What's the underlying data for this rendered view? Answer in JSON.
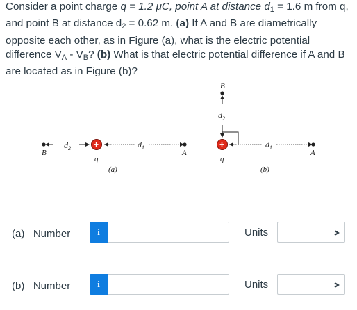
{
  "question": {
    "p1": "Consider a point charge ",
    "q_eq": "q = 1.2 μC, point A at distance d",
    "sub1": "1",
    "p2": " = 1.6 m from q, and point B at distance d",
    "sub2": "2",
    "p3": " = 0.62 m. ",
    "part_a_tag": "(a)",
    "p4": " If A and B are diametrically opposite each other, as in Figure (a), what is the electric potential difference V",
    "subA": "A",
    "p5": " - V",
    "subB": "B",
    "p6": "? ",
    "part_b_tag": "(b)",
    "p7": " What is that electric potential difference if A and B are located as in Figure (b)?"
  },
  "figure_a": {
    "label_B": "B",
    "label_d2": "d",
    "label_d2_sub": "2",
    "label_q": "q",
    "label_d1": "d",
    "label_d1_sub": "1",
    "label_A": "A",
    "caption": "(a)",
    "charge_sign": "+"
  },
  "figure_b": {
    "label_B": "B",
    "label_d2": "d",
    "label_d2_sub": "2",
    "label_q": "q",
    "label_d1": "d",
    "label_d1_sub": "1",
    "label_A": "A",
    "caption": "(b)",
    "charge_sign": "+"
  },
  "answers": {
    "a": {
      "label": "(a)   Number",
      "info": "i",
      "units_label": "Units",
      "value": "",
      "unit": ""
    },
    "b": {
      "label": "(b)   Number",
      "info": "i",
      "units_label": "Units",
      "value": "",
      "unit": ""
    }
  },
  "colors": {
    "charge": "#e02a1a",
    "info_button": "#0f7de0",
    "text": "#2d3b45"
  }
}
